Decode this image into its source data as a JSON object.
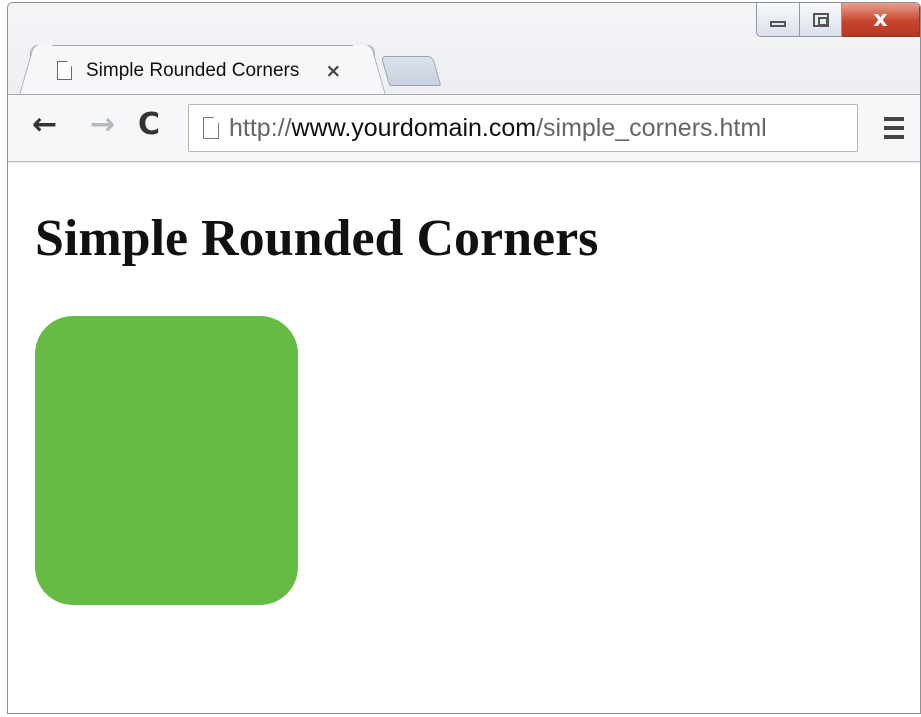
{
  "browser": {
    "tab": {
      "title": "Simple Rounded Corners",
      "close_glyph": "×",
      "icon": "page-icon"
    },
    "new_tab": {
      "icon": "new-tab"
    },
    "window_controls": {
      "minimize": "minimize-icon",
      "maximize": "maximize-icon",
      "close": "x"
    },
    "toolbar": {
      "back_glyph": "←",
      "forward_glyph": "→",
      "reload_glyph": "C",
      "url_scheme": "http://",
      "url_host": "www.yourdomain.com",
      "url_path": "/simple_corners.html",
      "menu_icon": "hamburger-menu-icon"
    }
  },
  "page": {
    "heading": "Simple Rounded Corners",
    "box_color": "#66bb44"
  }
}
